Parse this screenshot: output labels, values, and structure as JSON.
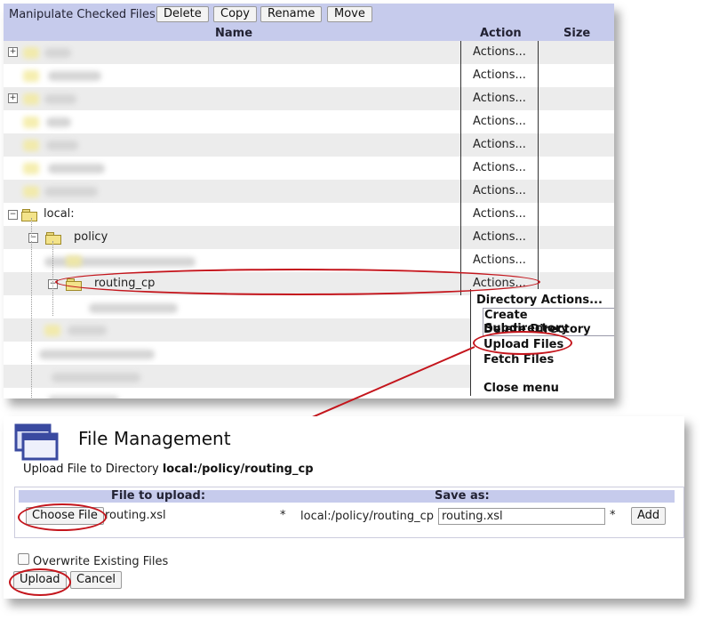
{
  "toolbar": {
    "label": "Manipulate Checked Files:",
    "buttons": [
      "Delete",
      "Copy",
      "Rename",
      "Move"
    ]
  },
  "table": {
    "headers": {
      "name": "Name",
      "action": "Action",
      "size": "Size"
    },
    "action_label": "Actions...",
    "folders": {
      "local": "local:",
      "policy": "policy",
      "routing": "routing_cp"
    }
  },
  "dir_menu": {
    "title": "Directory Actions...",
    "items": [
      "Create Subdirectory",
      "Delete Directory",
      "Upload Files",
      "Fetch Files"
    ],
    "close": "Close menu"
  },
  "file_management": {
    "title": "File Management",
    "upload_prefix": "Upload File to Directory",
    "upload_path": "local:/policy/routing_cp",
    "col_file": "File to upload:",
    "col_save": "Save as:",
    "choose_button": "Choose File",
    "chosen_file": "routing.xsl",
    "required_mark": "*",
    "save_dir": "local:/policy/routing_cp",
    "save_value": "routing.xsl",
    "add_button": "Add",
    "overwrite_label": "Overwrite Existing Files",
    "upload_button": "Upload",
    "cancel_button": "Cancel"
  },
  "colors": {
    "header_bg": "#c6cbec",
    "highlight": "#c4151c",
    "shade": "#ececec"
  }
}
